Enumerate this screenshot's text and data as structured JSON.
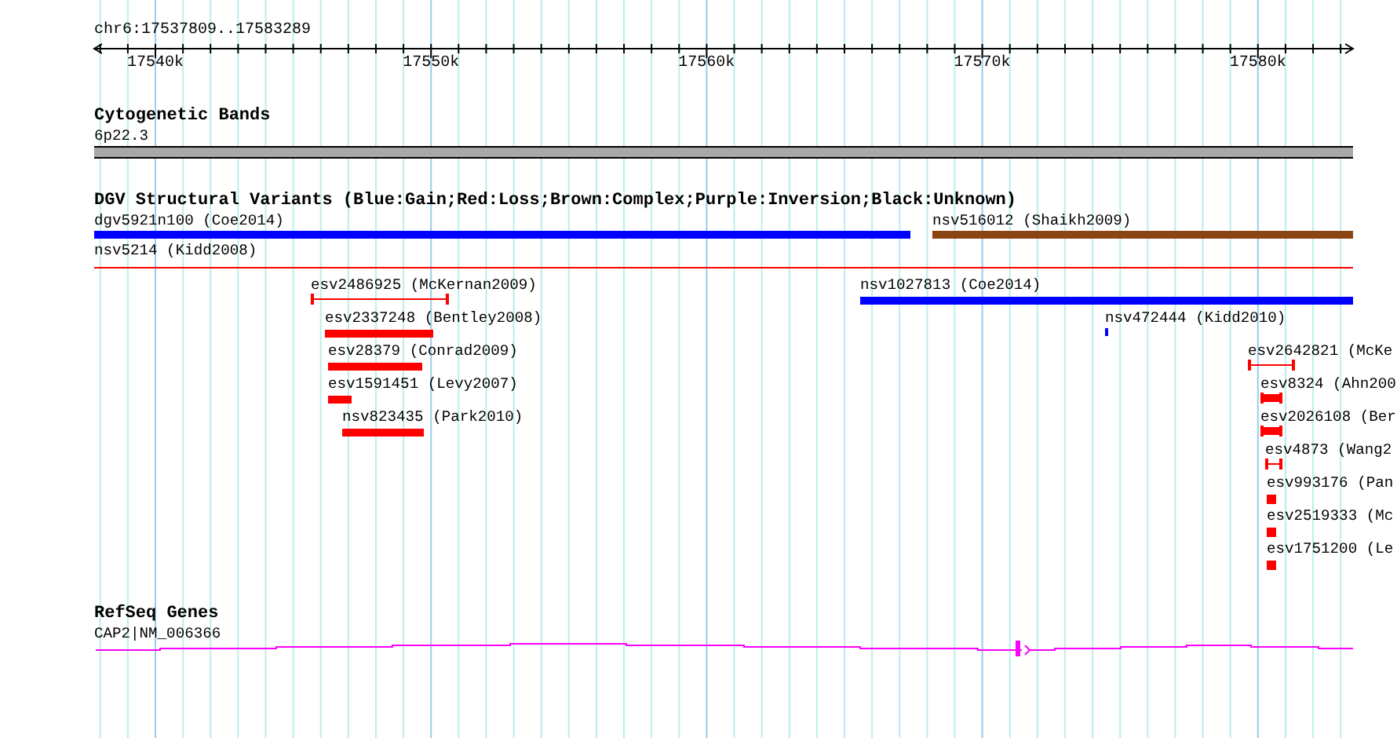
{
  "ruler": {
    "region": "chr6:17537809..17583289",
    "ticks": [
      "17540k",
      "17550k",
      "17560k",
      "17570k",
      "17580k"
    ]
  },
  "tracks": [
    {
      "title": "Cytogenetic Bands",
      "features": [
        {
          "kind": "band",
          "label": "6p22.3"
        }
      ]
    },
    {
      "title": "DGV Structural Variants (Blue:Gain;Red:Loss;Brown:Complex;Purple:Inversion;Black:Unknown)",
      "features": [
        {
          "kind": "bar",
          "label": "dgv5921n100 (Coe2014)",
          "color": "#0000ff"
        },
        {
          "kind": "bar",
          "label": "nsv516012 (Shaikh2009)",
          "color": "#8b4513"
        },
        {
          "kind": "line",
          "label": "nsv5214 (Kidd2008)",
          "color": "#ff0000"
        },
        {
          "kind": "interval",
          "label": "esv2486925 (McKernan2009)",
          "color": "#ff0000"
        },
        {
          "kind": "bar",
          "label": "nsv1027813 (Coe2014)",
          "color": "#0000ff"
        },
        {
          "kind": "bar",
          "label": "esv2337248 (Bentley2008)",
          "color": "#ff0000"
        },
        {
          "kind": "bar",
          "label": "nsv472444 (Kidd2010)",
          "color": "#0000ff"
        },
        {
          "kind": "bar",
          "label": "esv28379 (Conrad2009)",
          "color": "#ff0000"
        },
        {
          "kind": "interval",
          "label": "esv2642821 (McKe",
          "color": "#ff0000"
        },
        {
          "kind": "bar",
          "label": "esv1591451 (Levy2007)",
          "color": "#ff0000"
        },
        {
          "kind": "block-interval",
          "label": "esv8324 (Ahn200",
          "color": "#ff0000"
        },
        {
          "kind": "bar",
          "label": "nsv823435 (Park2010)",
          "color": "#ff0000"
        },
        {
          "kind": "block-interval",
          "label": "esv2026108 (Ber",
          "color": "#ff0000"
        },
        {
          "kind": "interval",
          "label": "esv4873 (Wang2",
          "color": "#ff0000"
        },
        {
          "kind": "bar",
          "label": "esv993176 (Pan",
          "color": "#ff0000"
        },
        {
          "kind": "bar",
          "label": "esv2519333 (Mc",
          "color": "#ff0000"
        },
        {
          "kind": "bar",
          "label": "esv1751200 (Le",
          "color": "#ff0000"
        }
      ]
    },
    {
      "title": "RefSeq Genes",
      "features": [
        {
          "kind": "gene",
          "label": "CAP2|NM_006366"
        }
      ]
    }
  ]
}
